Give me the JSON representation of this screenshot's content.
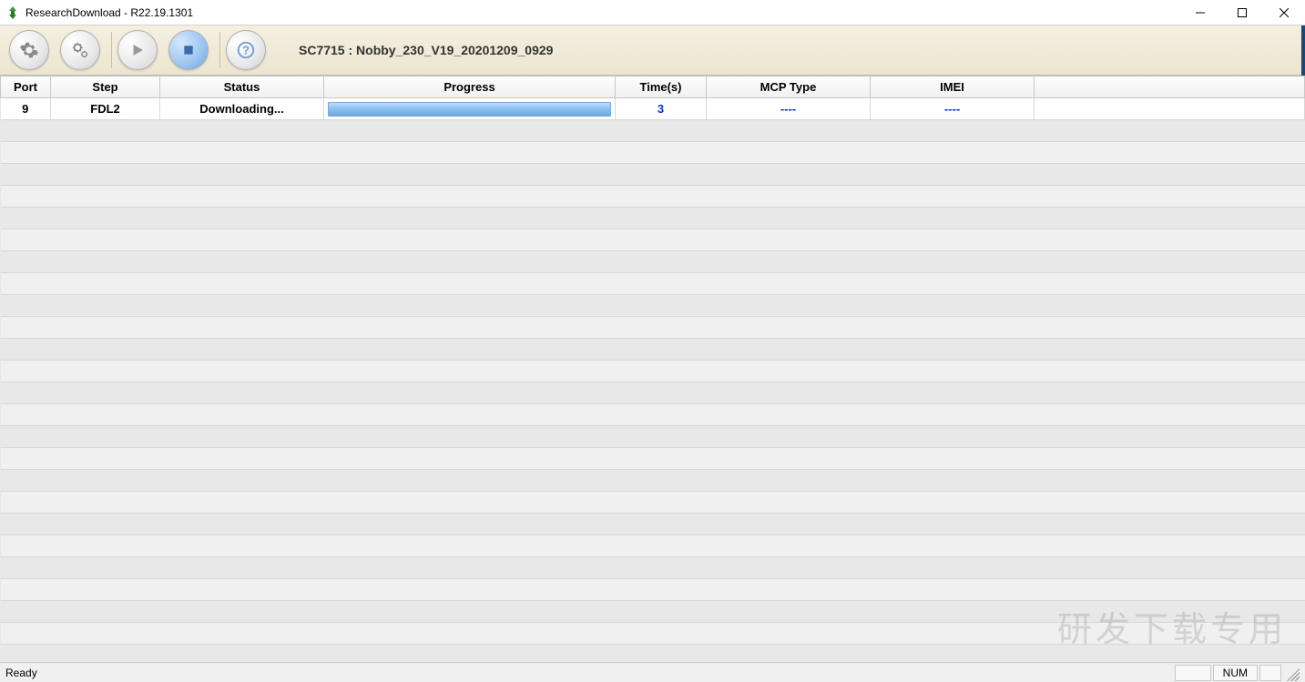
{
  "window": {
    "title": "ResearchDownload - R22.19.1301"
  },
  "toolbar": {
    "device_label": "SC7715 : Nobby_230_V19_20201209_0929"
  },
  "table": {
    "headers": [
      "Port",
      "Step",
      "Status",
      "Progress",
      "Time(s)",
      "MCP Type",
      "IMEI"
    ],
    "rows": [
      {
        "port": "9",
        "step": "FDL2",
        "status": "Downloading...",
        "progress_pct": 100,
        "time": "3",
        "mcp": "----",
        "imei": "----"
      }
    ]
  },
  "statusbar": {
    "ready": "Ready",
    "num": "NUM"
  },
  "watermark": "研发下载专用"
}
